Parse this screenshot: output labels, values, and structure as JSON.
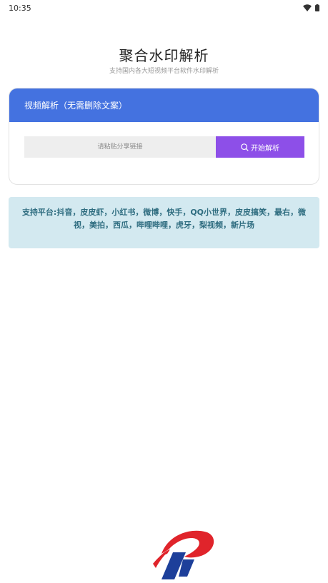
{
  "status_bar": {
    "time": "10:35",
    "icons": [
      "wifi-icon",
      "battery-icon"
    ]
  },
  "header": {
    "title": "聚合水印解析",
    "subtitle": "支持国内各大短视频平台软件水印解析"
  },
  "card": {
    "header_title": "视频解析（无需删除文案）",
    "input_placeholder": "请粘贴分享链接",
    "input_value": "",
    "parse_button_label": "开始解析",
    "parse_button_icon": "search-icon"
  },
  "platforms": {
    "text": "支持平台:抖音，皮皮虾，小红书，微博，快手，QQ小世界，皮皮搞笑，最右，微视，美拍，西瓜，哔哩哔哩，虎牙，梨视频，新片场"
  },
  "colors": {
    "card_header": "#4472e0",
    "parse_button": "#8d4fe8",
    "platform_bg": "#d3e9f0",
    "platform_text": "#2f6d80",
    "logo_red": "#e0242b",
    "logo_blue": "#1d3f9a"
  },
  "logo": {
    "icon": "brand-logo-icon"
  }
}
